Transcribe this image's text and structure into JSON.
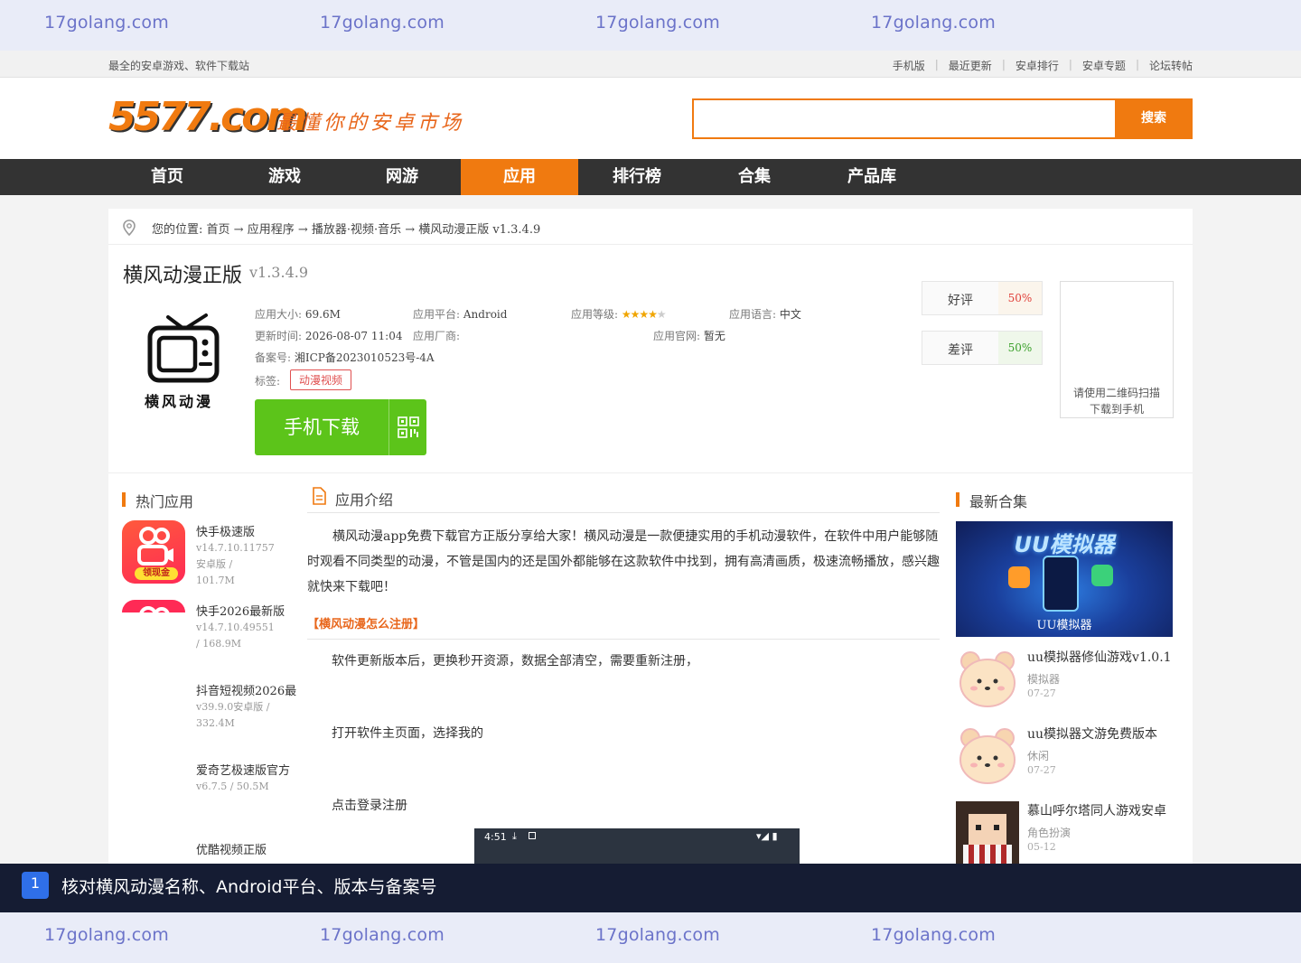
{
  "watermark": {
    "text": "17golang.com"
  },
  "topbar": {
    "tagline": "最全的安卓游戏、软件下载站",
    "links": [
      "手机版",
      "最近更新",
      "安卓排行",
      "安卓专题",
      "论坛转帖"
    ]
  },
  "header": {
    "logo_text": "5577.com",
    "slogan": "最懂你的安卓市场",
    "search_value": "",
    "search_button": "搜索"
  },
  "nav": {
    "items": [
      "首页",
      "游戏",
      "网游",
      "应用",
      "排行榜",
      "合集",
      "产品库"
    ],
    "active": "应用"
  },
  "breadcrumb": {
    "prefix": "您的位置:",
    "path": "首页 → 应用程序 → 播放器·视频·音乐 → 横风动漫正版 v1.3.4.9"
  },
  "app": {
    "name": "横风动漫正版",
    "version": "v1.3.4.9",
    "icon_caption": "横风动漫",
    "size_label": "应用大小:",
    "size": "69.6M",
    "platform_label": "应用平台:",
    "platform": "Android",
    "rating_label": "应用等级:",
    "rating_stars": 4,
    "language_label": "应用语言:",
    "language": "中文",
    "updated_label": "更新时间:",
    "updated": "2026-08-07 11:04",
    "vendor_label": "应用厂商:",
    "vendor": "",
    "site_label": "应用官网:",
    "site": "暂无",
    "icp_label": "备案号:",
    "icp": "湘ICP备2023010523号-4A",
    "tags_label": "标签:",
    "tag": "动漫视频",
    "download_label": "手机下载"
  },
  "votes": {
    "good_label": "好评",
    "good_value": "50%",
    "good_color": "#e0403a",
    "bad_label": "差评",
    "bad_value": "50%",
    "bad_color": "#3aa02a"
  },
  "qr": {
    "text_line1": "请使用二维码扫描",
    "text_line2": "下载到手机"
  },
  "hot": {
    "title": "热门应用",
    "items": [
      {
        "name": "快手极速版",
        "meta": "v14.7.10.11757安卓版 / 101.7M"
      },
      {
        "name": "快手2026最新版",
        "meta": "v14.7.10.49551 / 168.9M"
      },
      {
        "name": "抖音短视频2026最",
        "meta": "v39.9.0安卓版 / 332.4M"
      },
      {
        "name": "爱奇艺极速版官方",
        "meta": "v6.7.5 / 50.5M"
      },
      {
        "name": "优酷视频正版",
        "meta": ""
      }
    ],
    "badge_text": "领现金"
  },
  "intro": {
    "title": "应用介绍",
    "para1": "横风动漫app免费下载官方正版分享给大家！横风动漫是一款便捷实用的手机动漫软件，在软件中用户能够随时观看不同类型的动漫，不管是国内的还是国外都能够在这款软件中找到，拥有高清画质，极速流畅播放，感兴趣就快来下载吧！",
    "subhead": "【横风动漫怎么注册】",
    "step1": "软件更新版本后，更换秒开资源，数据全部清空，需要重新注册，",
    "step2": "打开软件主页面，选择我的",
    "step3": "点击登录注册",
    "phone_time": "4:51"
  },
  "collections": {
    "title": "最新合集",
    "banner_title": "UU模拟器",
    "banner_caption": "UU模拟器",
    "items": [
      {
        "name": "uu模拟器修仙游戏v1.0.1",
        "category": "模拟器",
        "date": "07-27"
      },
      {
        "name": "uu模拟器文游免费版本",
        "category": "休闲",
        "date": "07-27"
      },
      {
        "name": "慕山呼尔塔同人游戏安卓",
        "category": "角色扮演",
        "date": "05-12"
      }
    ]
  },
  "caption": {
    "number": "1",
    "text": "核对横风动漫名称、Android平台、版本与备案号"
  }
}
